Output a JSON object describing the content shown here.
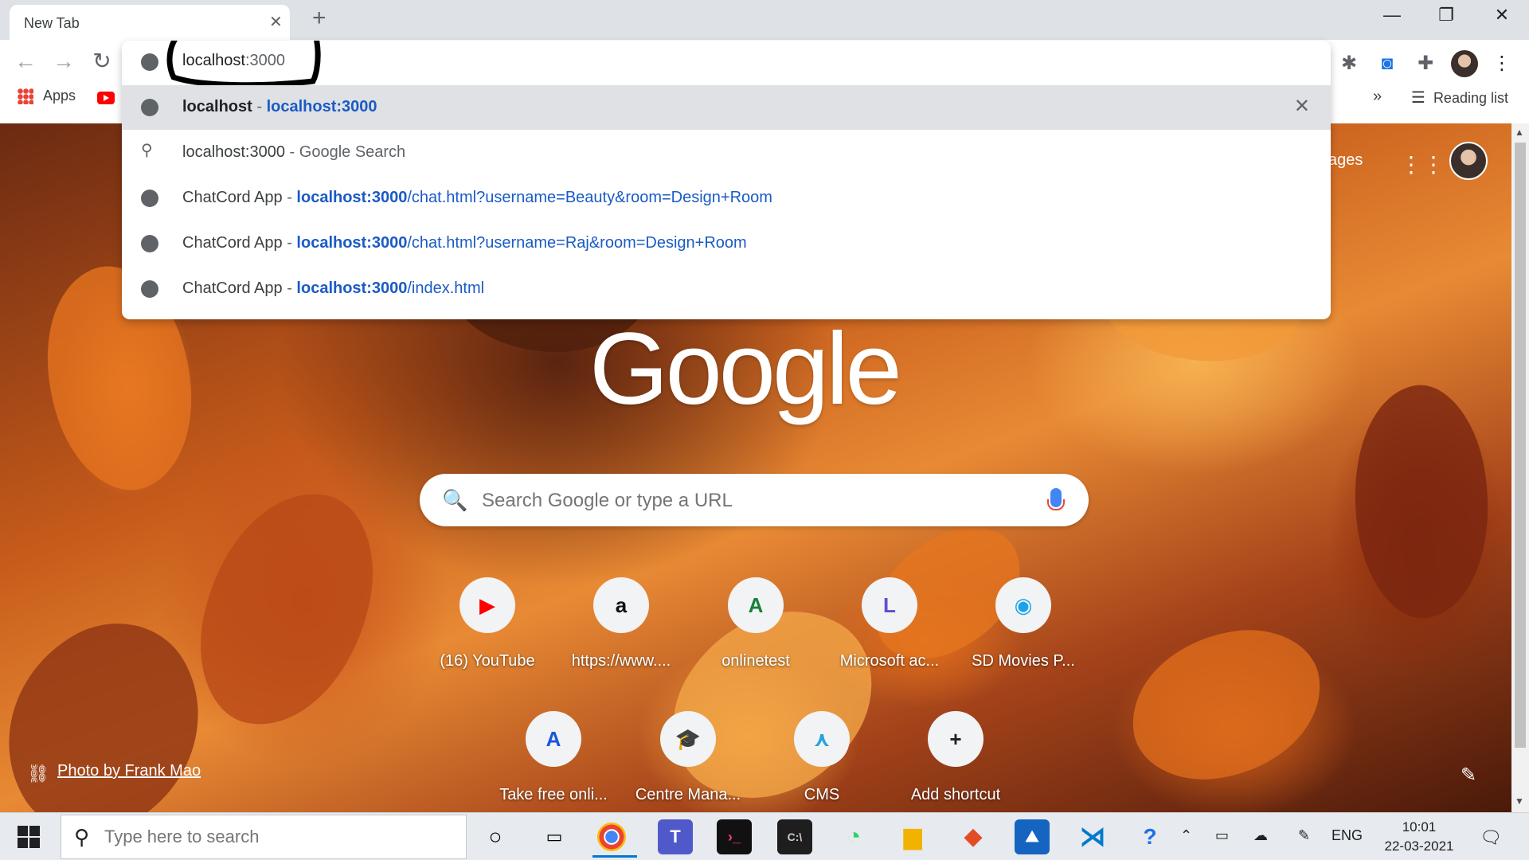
{
  "browser": {
    "tab_title": "New Tab",
    "tab_close": "✕",
    "new_tab": "+",
    "window": {
      "minimize": "—",
      "restore": "❐",
      "close": "✕"
    }
  },
  "toolbar": {
    "back": "←",
    "forward": "→",
    "reload": "↻",
    "omnibox_value_host": "localhost",
    "omnibox_value_rest": ":3000",
    "extensions": [
      "bug-icon",
      "screen-record-icon",
      "puzzle-icon"
    ],
    "menu": "⋮"
  },
  "bookmarks": {
    "apps_label": "Apps",
    "overflow": "»",
    "reading_list": "Reading list"
  },
  "suggestions": [
    {
      "title": "localhost",
      "sep": " - ",
      "url_bold": "localhost:3000",
      "url_rest": "",
      "icon": "globe-icon",
      "selected": true,
      "remove": "✕"
    },
    {
      "title": "localhost:3000",
      "sep": " - ",
      "url_bold": "",
      "url_rest": "Google Search",
      "icon": "search-icon"
    },
    {
      "title": "ChatCord App",
      "sep": " - ",
      "url_bold": "localhost:3000",
      "url_rest": "/chat.html?username=Beauty&room=Design+Room",
      "icon": "globe-icon"
    },
    {
      "title": "ChatCord App",
      "sep": " - ",
      "url_bold": "localhost:3000",
      "url_rest": "/chat.html?username=Raj&room=Design+Room",
      "icon": "globe-icon"
    },
    {
      "title": "ChatCord App",
      "sep": " - ",
      "url_bold": "localhost:3000",
      "url_rest": "/index.html",
      "icon": "globe-icon"
    }
  ],
  "ntp": {
    "logo": "Google",
    "images_link": "ages",
    "search_placeholder": "Search Google or type a URL",
    "photo_credit": "Photo by Frank Mao",
    "shortcuts": [
      {
        "label": "(16) YouTube",
        "icon": "youtube-icon",
        "glyph": "▶",
        "color": "#ff0000"
      },
      {
        "label": "https://www....",
        "icon": "amazon-icon",
        "glyph": "a",
        "color": "#111111"
      },
      {
        "label": "onlinetest",
        "icon": "letter-a-icon",
        "glyph": "A",
        "color": "#188038"
      },
      {
        "label": "Microsoft ac...",
        "icon": "letter-l-icon",
        "glyph": "L",
        "color": "#5b4fcf"
      },
      {
        "label": "SD Movies P...",
        "icon": "camera-icon",
        "glyph": "◉",
        "color": "#1aa3e8"
      },
      {
        "label": "Take free onli...",
        "icon": "letter-a-blue-icon",
        "glyph": "A",
        "color": "#1a56db"
      },
      {
        "label": "Centre Mana...",
        "icon": "graduation-cap-icon",
        "glyph": "🎓",
        "color": "#f07b1f"
      },
      {
        "label": "CMS",
        "icon": "cms-icon",
        "glyph": "⋏",
        "color": "#29a3dc"
      },
      {
        "label": "Add shortcut",
        "icon": "plus-icon",
        "glyph": "+",
        "color": "#202124"
      }
    ]
  },
  "taskbar": {
    "search_placeholder": "Type here to search",
    "language": "ENG",
    "time": "10:01",
    "date": "22-03-2021"
  },
  "colors": {
    "accent": "#1a5bc4",
    "taskbar": "#e7eaee",
    "selected_row": "#dfe1e5"
  }
}
